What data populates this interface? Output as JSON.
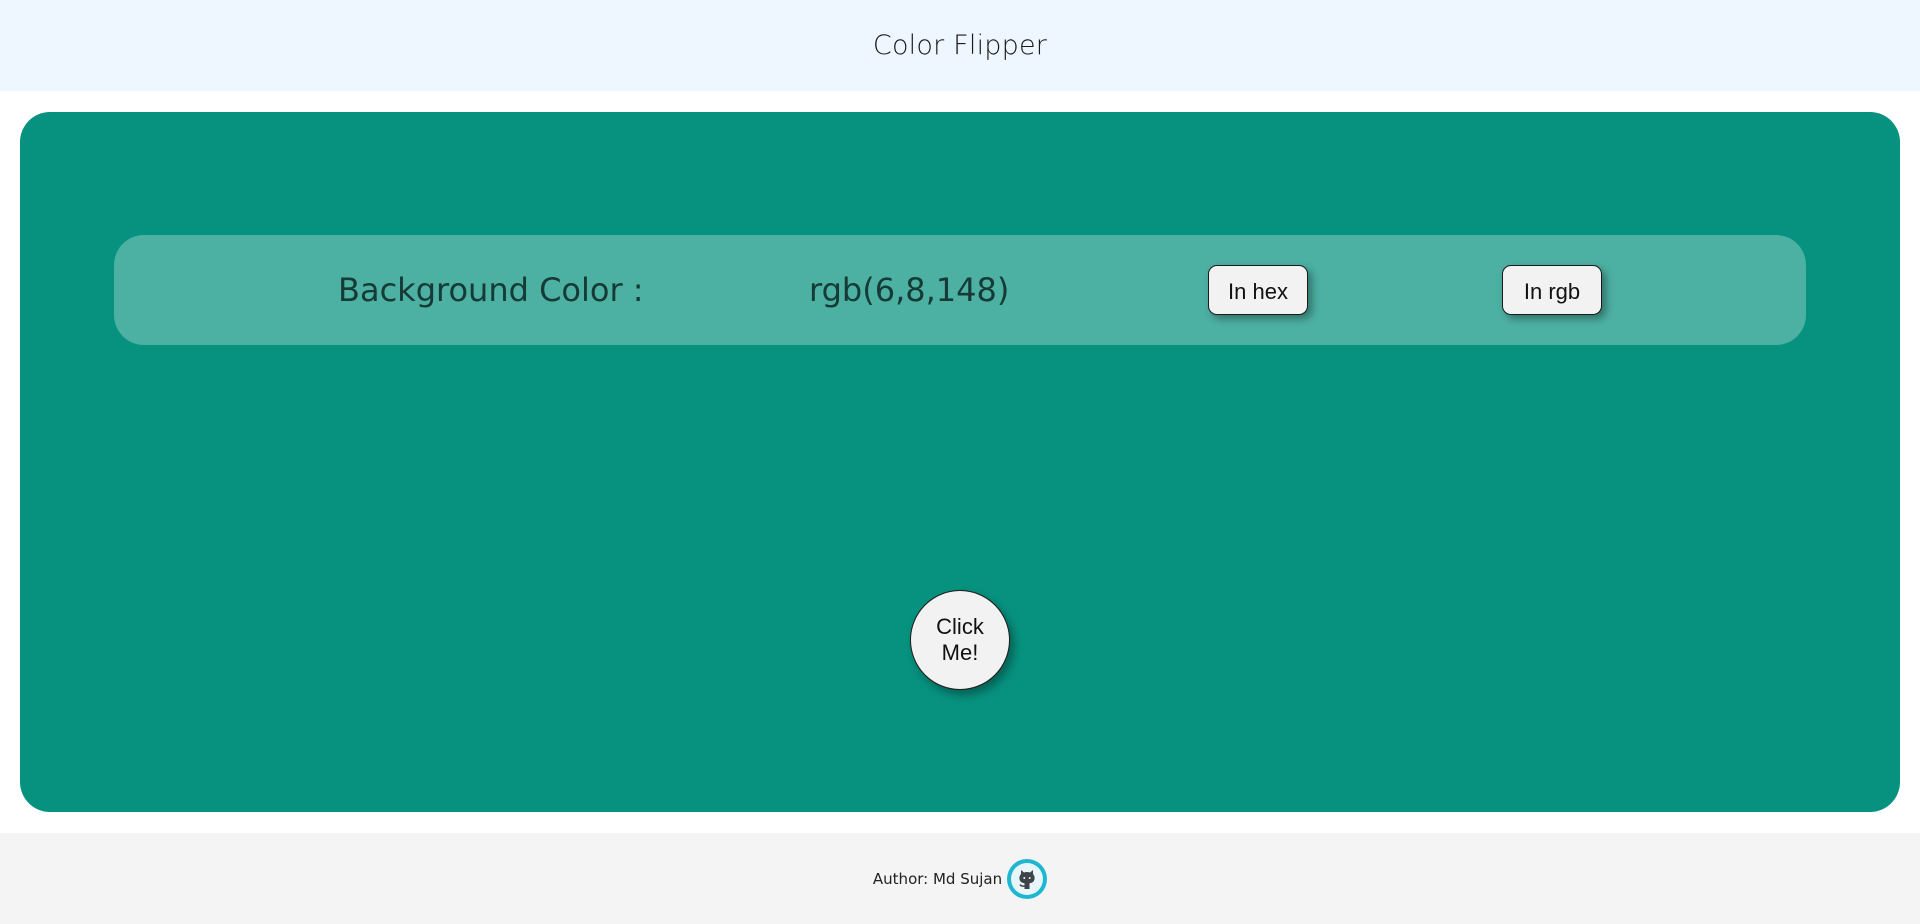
{
  "header": {
    "title": "Color Flipper"
  },
  "main": {
    "background_color": "#07927f",
    "label": "Background Color :",
    "value": "rgb(6,8,148)",
    "hex_button": "In hex",
    "rgb_button": "In rgb",
    "click_button_line1": "Click",
    "click_button_line2": "Me!"
  },
  "footer": {
    "author": "Author: Md Sujan",
    "github_icon": "github-icon"
  }
}
